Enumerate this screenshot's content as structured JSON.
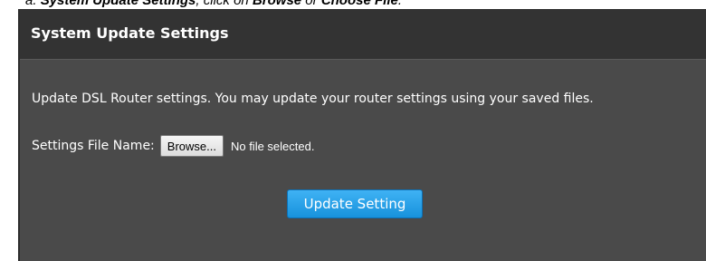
{
  "caption": {
    "prefix": "a. ",
    "bold_section": "System Update Settings",
    "middle": ", click on ",
    "browse_word": "Browse",
    "or_word": " or ",
    "choose_file": "Choose File",
    "suffix": "."
  },
  "panel": {
    "title": "System Update Settings",
    "description": "Update DSL Router settings. You may update your router settings using your saved files.",
    "file_label": "Settings File Name:",
    "browse_label": "Browse...",
    "file_status": "No file selected.",
    "update_button_label": "Update Setting"
  },
  "colors": {
    "panel_background": "#4a4a4a",
    "header_background": "#333333",
    "update_button": "#2aa3ea"
  }
}
